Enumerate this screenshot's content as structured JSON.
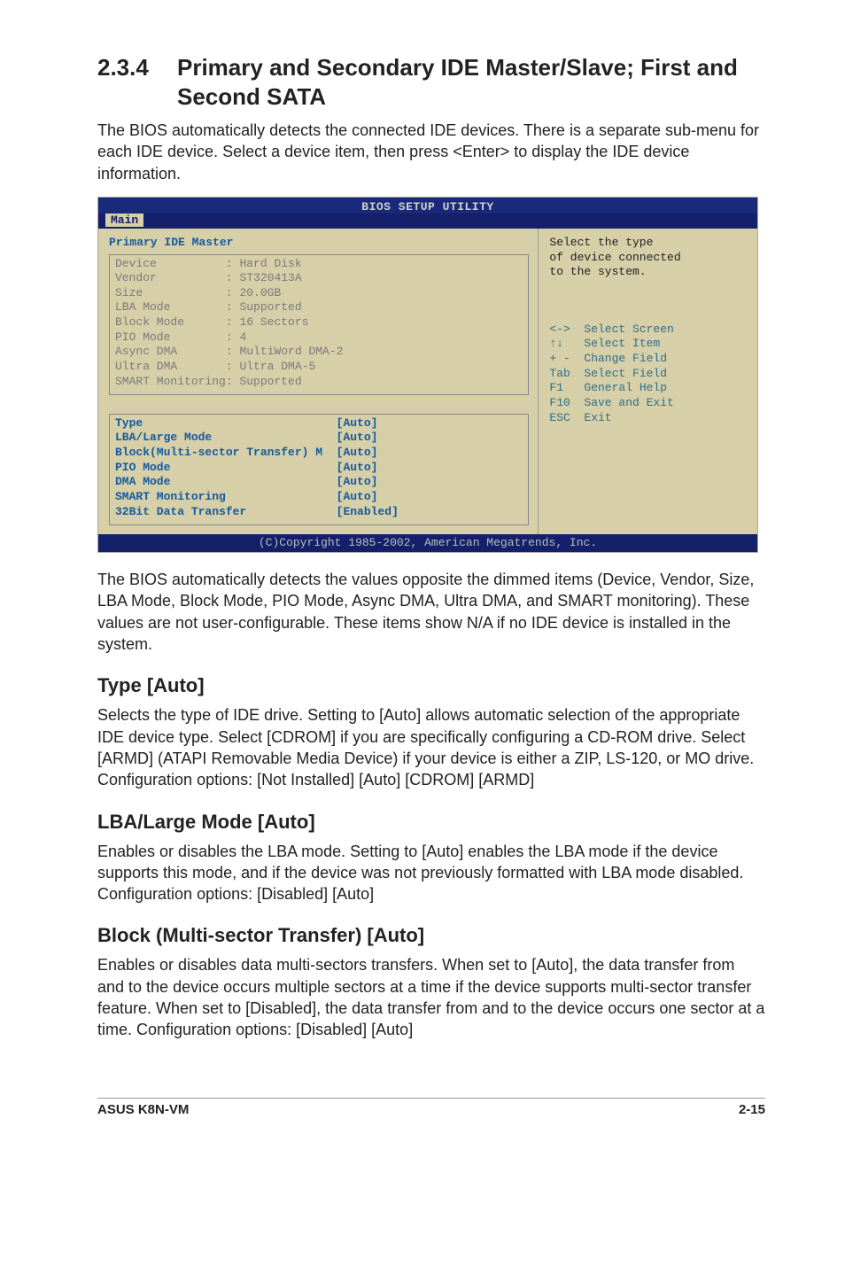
{
  "section": {
    "number": "2.3.4",
    "title": "Primary and Secondary IDE Master/Slave; First and Second SATA"
  },
  "intro_para": "The BIOS automatically detects the connected IDE devices. There is a separate sub-menu for each IDE device. Select a device item, then press <Enter> to display the IDE device information.",
  "bios": {
    "title": "BIOS SETUP UTILITY",
    "tab": "Main",
    "panel_title": "Primary IDE Master",
    "device_rows": [
      {
        "label": "Device",
        "value": "Hard Disk"
      },
      {
        "label": "Vendor",
        "value": "ST320413A"
      },
      {
        "label": "Size",
        "value": "20.0GB"
      },
      {
        "label": "LBA Mode",
        "value": "Supported"
      },
      {
        "label": "Block Mode",
        "value": "16 Sectors"
      },
      {
        "label": "PIO Mode",
        "value": "4"
      },
      {
        "label": "Async DMA",
        "value": "MultiWord DMA-2"
      },
      {
        "label": "Ultra DMA",
        "value": "Ultra DMA-5"
      }
    ],
    "smart_line": "SMART Monitoring: Supported",
    "config_rows": [
      {
        "label": "Type",
        "value": "[Auto]"
      },
      {
        "label": "LBA/Large Mode",
        "value": "[Auto]"
      },
      {
        "label": "Block(Multi-sector Transfer) M",
        "value": "[Auto]"
      },
      {
        "label": "PIO Mode",
        "value": "[Auto]"
      },
      {
        "label": "DMA Mode",
        "value": "[Auto]"
      },
      {
        "label": "SMART Monitoring",
        "value": "[Auto]"
      },
      {
        "label": "32Bit Data Transfer",
        "value": "[Enabled]"
      }
    ],
    "help_top": "Select the type\nof device connected\nto the system.",
    "nav": [
      {
        "key": "<->",
        "desc": "Select Screen"
      },
      {
        "key": "↑↓",
        "desc": "Select Item"
      },
      {
        "key": "+ -",
        "desc": "Change Field"
      },
      {
        "key": "Tab",
        "desc": "Select Field"
      },
      {
        "key": "F1",
        "desc": "General Help"
      },
      {
        "key": "F10",
        "desc": "Save and Exit"
      },
      {
        "key": "ESC",
        "desc": "Exit"
      }
    ],
    "footer": "(C)Copyright 1985-2002, American Megatrends, Inc."
  },
  "after_bios_para": "The BIOS automatically detects the values opposite the dimmed items (Device, Vendor, Size, LBA Mode, Block Mode, PIO Mode, Async DMA, Ultra DMA, and SMART monitoring). These values are not user-configurable. These items show N/A if no IDE device is installed in the system.",
  "type_section": {
    "heading": "Type [Auto]",
    "para": "Selects the type of IDE drive. Setting to [Auto] allows automatic selection of the appropriate IDE device type. Select [CDROM] if you are specifically configuring a CD-ROM drive. Select [ARMD] (ATAPI Removable Media Device) if your device is either a ZIP, LS-120, or MO drive.\nConfiguration options: [Not Installed] [Auto] [CDROM] [ARMD]"
  },
  "lba_section": {
    "heading": "LBA/Large Mode [Auto]",
    "para": "Enables or disables the LBA mode. Setting to [Auto] enables the LBA mode if the device supports this mode, and if the device was not previously formatted with LBA mode disabled. Configuration options: [Disabled] [Auto]"
  },
  "block_section": {
    "heading": "Block (Multi-sector Transfer) [Auto]",
    "para": "Enables or disables data multi-sectors transfers. When set to [Auto], the data transfer from and to the device occurs multiple sectors at a time if the device supports multi-sector transfer feature. When set to [Disabled], the data transfer from and to the device occurs one sector at a time. Configuration options: [Disabled] [Auto]"
  },
  "footer": {
    "left": "ASUS K8N-VM",
    "right": "2-15"
  }
}
